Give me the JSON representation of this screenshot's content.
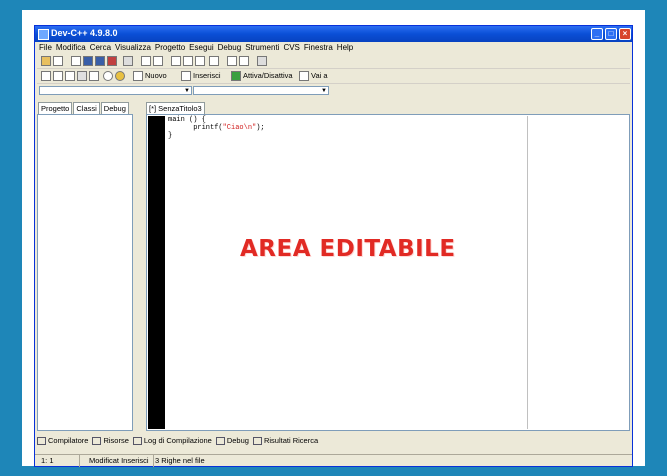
{
  "window": {
    "title": "Dev-C++ 4.9.8.0"
  },
  "menubar": [
    "File",
    "Modifica",
    "Cerca",
    "Visualizza",
    "Progetto",
    "Esegui",
    "Debug",
    "Strumenti",
    "CVS",
    "Finestra",
    "Help"
  ],
  "toolbar": {
    "new_label": "Nuovo",
    "insert_label": "Inserisci",
    "toggle_label": "Attiva/Disattiva",
    "goto_label": "Vai a"
  },
  "left_tabs": [
    "Progetto",
    "Classi",
    "Debug"
  ],
  "editor": {
    "tab_label": "[*] SenzaTitolo3",
    "code_line1": "main () {",
    "code_line2_prefix": "      printf(",
    "code_line2_string": "\"Ciao\\n\"",
    "code_line2_suffix": ");",
    "code_line3": "}"
  },
  "overlay_label": "AREA EDITABILE",
  "bottom_tabs": [
    "Compilatore",
    "Risorse",
    "Log di Compilazione",
    "Debug",
    "Risultati Ricerca"
  ],
  "status": {
    "position": "1:  1",
    "mode": "Modificat  Inserisci",
    "lines": "3 Righe nel file"
  },
  "colors": {
    "background": "#1e86b8",
    "titlebar": "#0a4fd6",
    "overlay_text": "#e12a24",
    "code_string": "#d11f1f"
  }
}
